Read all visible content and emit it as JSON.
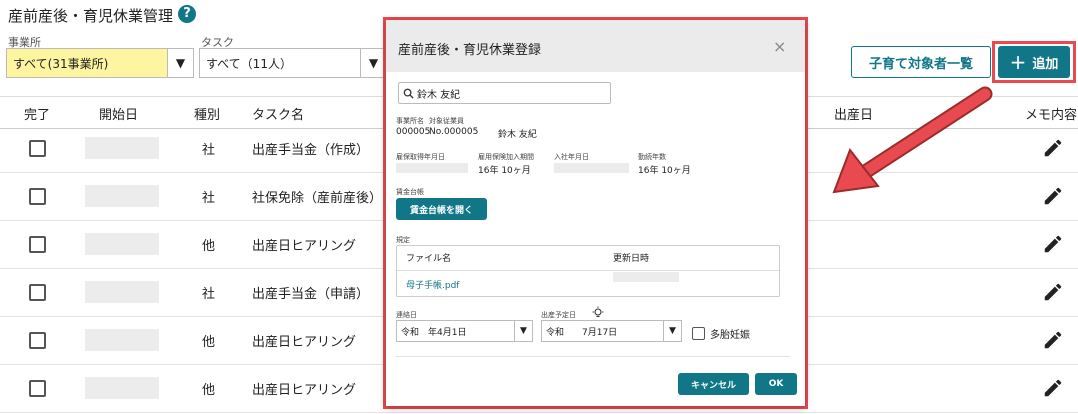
{
  "page": {
    "title": "産前産後・育児休業管理",
    "help": "?"
  },
  "filters": {
    "office_label": "事業所",
    "office_value": "すべて(31事業所)",
    "task_label": "タスク",
    "task_value": "すべて（11人）",
    "arrow": "▼"
  },
  "toolbar": {
    "list_button": "子育て対象者一覧",
    "add_plus": "+",
    "add_button": "追加"
  },
  "table": {
    "headers": {
      "done": "完了",
      "start": "開始日",
      "kind": "種別",
      "task": "タスク名",
      "birth": "出産日",
      "memo": "メモ内容"
    },
    "rows": [
      {
        "kind": "社",
        "task": "出産手当金（作成）"
      },
      {
        "kind": "社",
        "task": "社保免除（産前産後）"
      },
      {
        "kind": "他",
        "task": "出産日ヒアリング"
      },
      {
        "kind": "社",
        "task": "出産手当金（申請）"
      },
      {
        "kind": "他",
        "task": "出産日ヒアリング"
      },
      {
        "kind": "他",
        "task": "出産日ヒアリング"
      }
    ]
  },
  "modal": {
    "title": "産前産後・育児休業登録",
    "close": "×",
    "search_value": "鈴木 友紀",
    "office_name_label": "事業所名",
    "office_name_value": "000005",
    "employee_label": "対象従業員",
    "employee_no": "No.000005",
    "employee_name": "鈴木 友紀",
    "insurance_date_label": "雇保取得年月日",
    "employment_period_label": "雇用保険加入期間",
    "employment_period_value": "16年 10ヶ月",
    "join_date_label": "入社年月日",
    "tenure_label": "勤続年数",
    "tenure_value": "16年 10ヶ月",
    "wage_ledger_label": "賃金台帳",
    "wage_ledger_button": "賃金台帳を開く",
    "rules_label": "規定",
    "file_name_header": "ファイル名",
    "updated_header": "更新日時",
    "file_name": "母子手帳.pdf",
    "contact_date_label": "連絡日",
    "contact_date_value": "令和　年4月1日",
    "due_date_label": "出産予定日",
    "due_date_value": "令和　　7月17日",
    "arrow": "▼",
    "twins_label": "多胎妊娠",
    "cancel_button": "キャンセル",
    "ok_button": "OK"
  }
}
